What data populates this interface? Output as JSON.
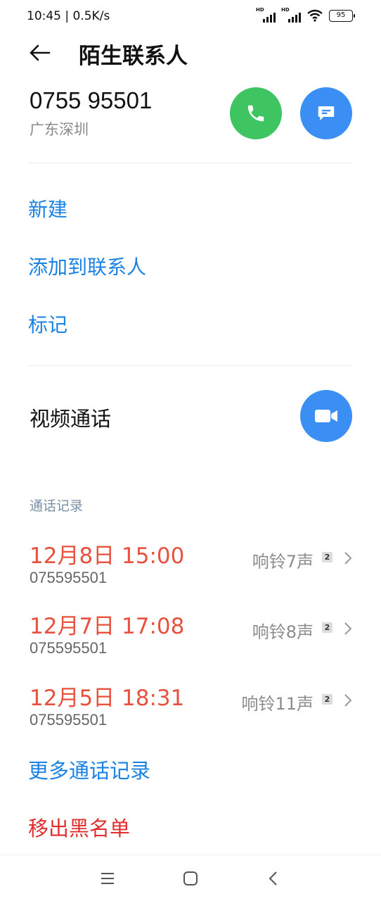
{
  "status_bar": {
    "time_speed": "10:45 | 0.5K/s",
    "signal1_label": "HD",
    "signal2_label": "HD",
    "battery": "95"
  },
  "header": {
    "title": "陌生联系人",
    "back_icon": "back-arrow-icon"
  },
  "contact": {
    "number": "0755 95501",
    "location": "广东深圳",
    "call_button_icon": "phone-icon",
    "message_button_icon": "message-icon"
  },
  "actions": {
    "new": "新建",
    "add_to_contacts": "添加到联系人",
    "mark": "标记"
  },
  "video": {
    "label": "视频通话",
    "icon": "video-camera-icon"
  },
  "call_log": {
    "section_label": "通话记录",
    "entries": [
      {
        "date": "12月8日 15:00",
        "number": "075595501",
        "status": "响铃7声",
        "sim": "2"
      },
      {
        "date": "12月7日 17:08",
        "number": "075595501",
        "status": "响铃8声",
        "sim": "2"
      },
      {
        "date": "12月5日 18:31",
        "number": "075595501",
        "status": "响铃11声",
        "sim": "2"
      }
    ],
    "more": "更多通话记录"
  },
  "unblock": "移出黑名单",
  "colors": {
    "accent_blue": "#1a82e4",
    "call_green": "#3ec460",
    "missed_red": "#e8513e",
    "danger_red": "#e02e2e"
  },
  "navbar": {
    "menu_icon": "menu-icon",
    "home_icon": "home-icon",
    "back_icon": "back-icon"
  }
}
